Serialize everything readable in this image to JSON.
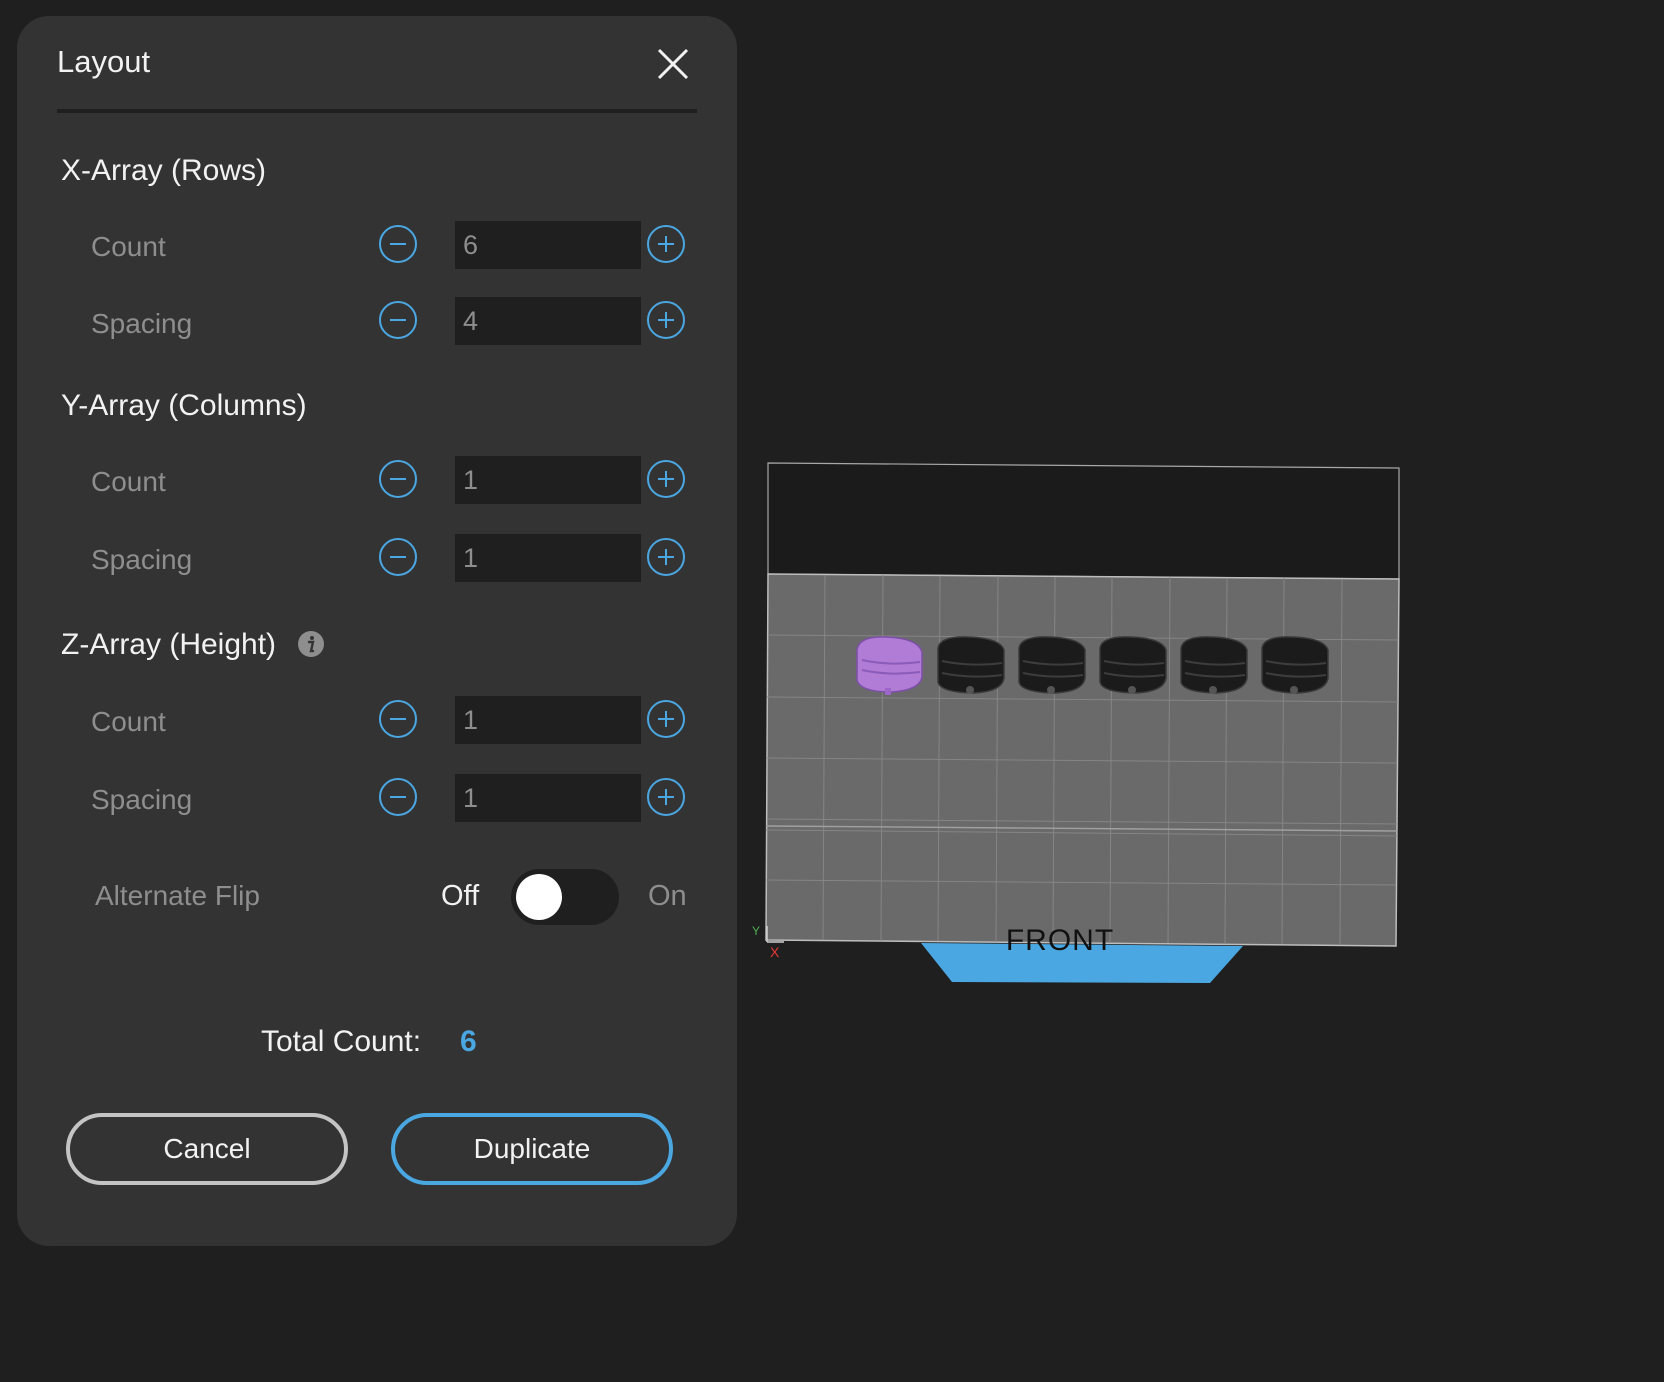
{
  "dialog": {
    "title": "Layout",
    "close_icon": "close-icon",
    "sections": [
      {
        "title": "X-Array (Rows)",
        "rows": [
          {
            "label": "Count",
            "value": "6"
          },
          {
            "label": "Spacing",
            "value": "4"
          }
        ]
      },
      {
        "title": "Y-Array (Columns)",
        "rows": [
          {
            "label": "Count",
            "value": "1"
          },
          {
            "label": "Spacing",
            "value": "1"
          }
        ]
      },
      {
        "title": "Z-Array (Height)",
        "info_icon": "info-icon",
        "rows": [
          {
            "label": "Count",
            "value": "1"
          },
          {
            "label": "Spacing",
            "value": "1"
          }
        ]
      }
    ],
    "alternate_flip": {
      "label": "Alternate Flip",
      "off_label": "Off",
      "on_label": "On",
      "state": "off"
    },
    "total": {
      "label": "Total Count:",
      "value": "6"
    },
    "buttons": {
      "cancel": "Cancel",
      "duplicate": "Duplicate"
    },
    "colors": {
      "accent": "#4aa7e2",
      "panel": "#333333",
      "background": "#1f1f1f"
    }
  },
  "viewport": {
    "front_label": "FRONT",
    "axis_y_label": "Y",
    "axis_x_label": "X",
    "objects": [
      {
        "name": "model-1",
        "selected": true,
        "color": "#b07cd6"
      },
      {
        "name": "model-2",
        "selected": false,
        "color": "#1a1a1a"
      },
      {
        "name": "model-3",
        "selected": false,
        "color": "#1a1a1a"
      },
      {
        "name": "model-4",
        "selected": false,
        "color": "#1a1a1a"
      },
      {
        "name": "model-5",
        "selected": false,
        "color": "#1a1a1a"
      },
      {
        "name": "model-6",
        "selected": false,
        "color": "#1a1a1a"
      }
    ]
  }
}
